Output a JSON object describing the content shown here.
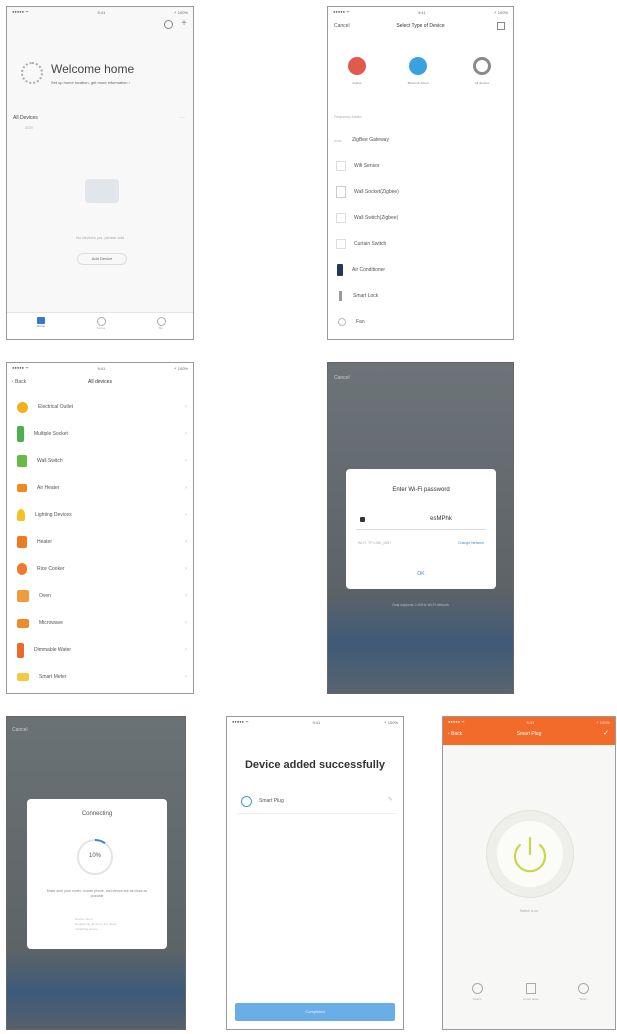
{
  "p1": {
    "status_left": "●●●●● ᯤ",
    "status_time": "9:41",
    "status_right": "⚡ 100%",
    "title": "Welcome home",
    "subtitle": "Set up home location, get more information ›",
    "section": "All Devices",
    "section_sub": "2/29",
    "empty_text": "No devices yet, please add",
    "add_button": "Add Device",
    "tabs": [
      "Home",
      "Scene",
      "Me"
    ]
  },
  "p2": {
    "status_left": "●●●●● ᯤ",
    "status_time": "9:41",
    "status_right": "⚡ 100%",
    "cancel": "Cancel",
    "title": "Select Type of Device",
    "quick": [
      {
        "label": "Zigbee",
        "color": "#e05a4e"
      },
      {
        "label": "Bluetooth Mesh",
        "color": "#3aa0e0"
      },
      {
        "label": "All devices",
        "color": "#8a8a8a"
      }
    ],
    "group_label": "Frequently Added",
    "items": [
      "ZigBee Gateway",
      "Wifi Sensor",
      "Wall Socket(Zigbee)",
      "Wall Switch(Zigbee)",
      "Curtain Switch",
      "Air Conditioner",
      "Smart Lock",
      "Fan"
    ]
  },
  "p3": {
    "status_left": "●●●●● ᯤ",
    "status_time": "9:41",
    "status_right": "⚡ 100%",
    "back": "‹ Back",
    "title": "All devices",
    "items": [
      {
        "label": "Electrical Outlet",
        "color": "#f2b01e"
      },
      {
        "label": "Multiple Socket",
        "color": "#4caf50"
      },
      {
        "label": "Wall Switch",
        "color": "#66bb44"
      },
      {
        "label": "Air Heater",
        "color": "#f08a1c"
      },
      {
        "label": "Lighting Devices",
        "color": "#f5c21b"
      },
      {
        "label": "Heater",
        "color": "#ee7a24"
      },
      {
        "label": "Rice Cooker",
        "color": "#f07a2c"
      },
      {
        "label": "Oven",
        "color": "#f09a3c"
      },
      {
        "label": "Microwave",
        "color": "#f08a2a"
      },
      {
        "label": "Dimmable Water",
        "color": "#ea6a2a"
      },
      {
        "label": "Smart Meter",
        "color": "#f5c842"
      }
    ]
  },
  "p4": {
    "cancel": "Cancel",
    "dialog_title": "Enter Wi-Fi password",
    "password": "esMPhk",
    "wifi_name": "Wi-Fi: TP-LINK_0557",
    "change_network": "Change Network",
    "ok": "OK",
    "note": "Only supports 2.4GHz Wi-Fi network"
  },
  "p5": {
    "cancel": "Cancel",
    "dialog_title": "Connecting",
    "progress_text": "10%",
    "progress": 0.1,
    "hint": "Make sure your router, mobile phone, and device are as close as possible",
    "sub_steps": [
      "Device found",
      "Registering device to the cloud",
      "Initializing device"
    ]
  },
  "p6": {
    "status_left": "●●●●● ᯤ",
    "status_time": "9:41",
    "status_right": "⚡ 100%",
    "title": "Device added successfully",
    "device_name": "Smart Plug",
    "edit": "✎",
    "completed": "Completed"
  },
  "p7": {
    "status_left": "●●●●● ᯤ",
    "status_time": "9:41",
    "status_right": "⚡ 100%",
    "back": "‹ Back",
    "title": "Smart Plug",
    "check": "✓",
    "state_text": "Switch is on",
    "bottom": [
      "Switch",
      "Count down",
      "Timer"
    ],
    "accent": "#f26b2a"
  }
}
